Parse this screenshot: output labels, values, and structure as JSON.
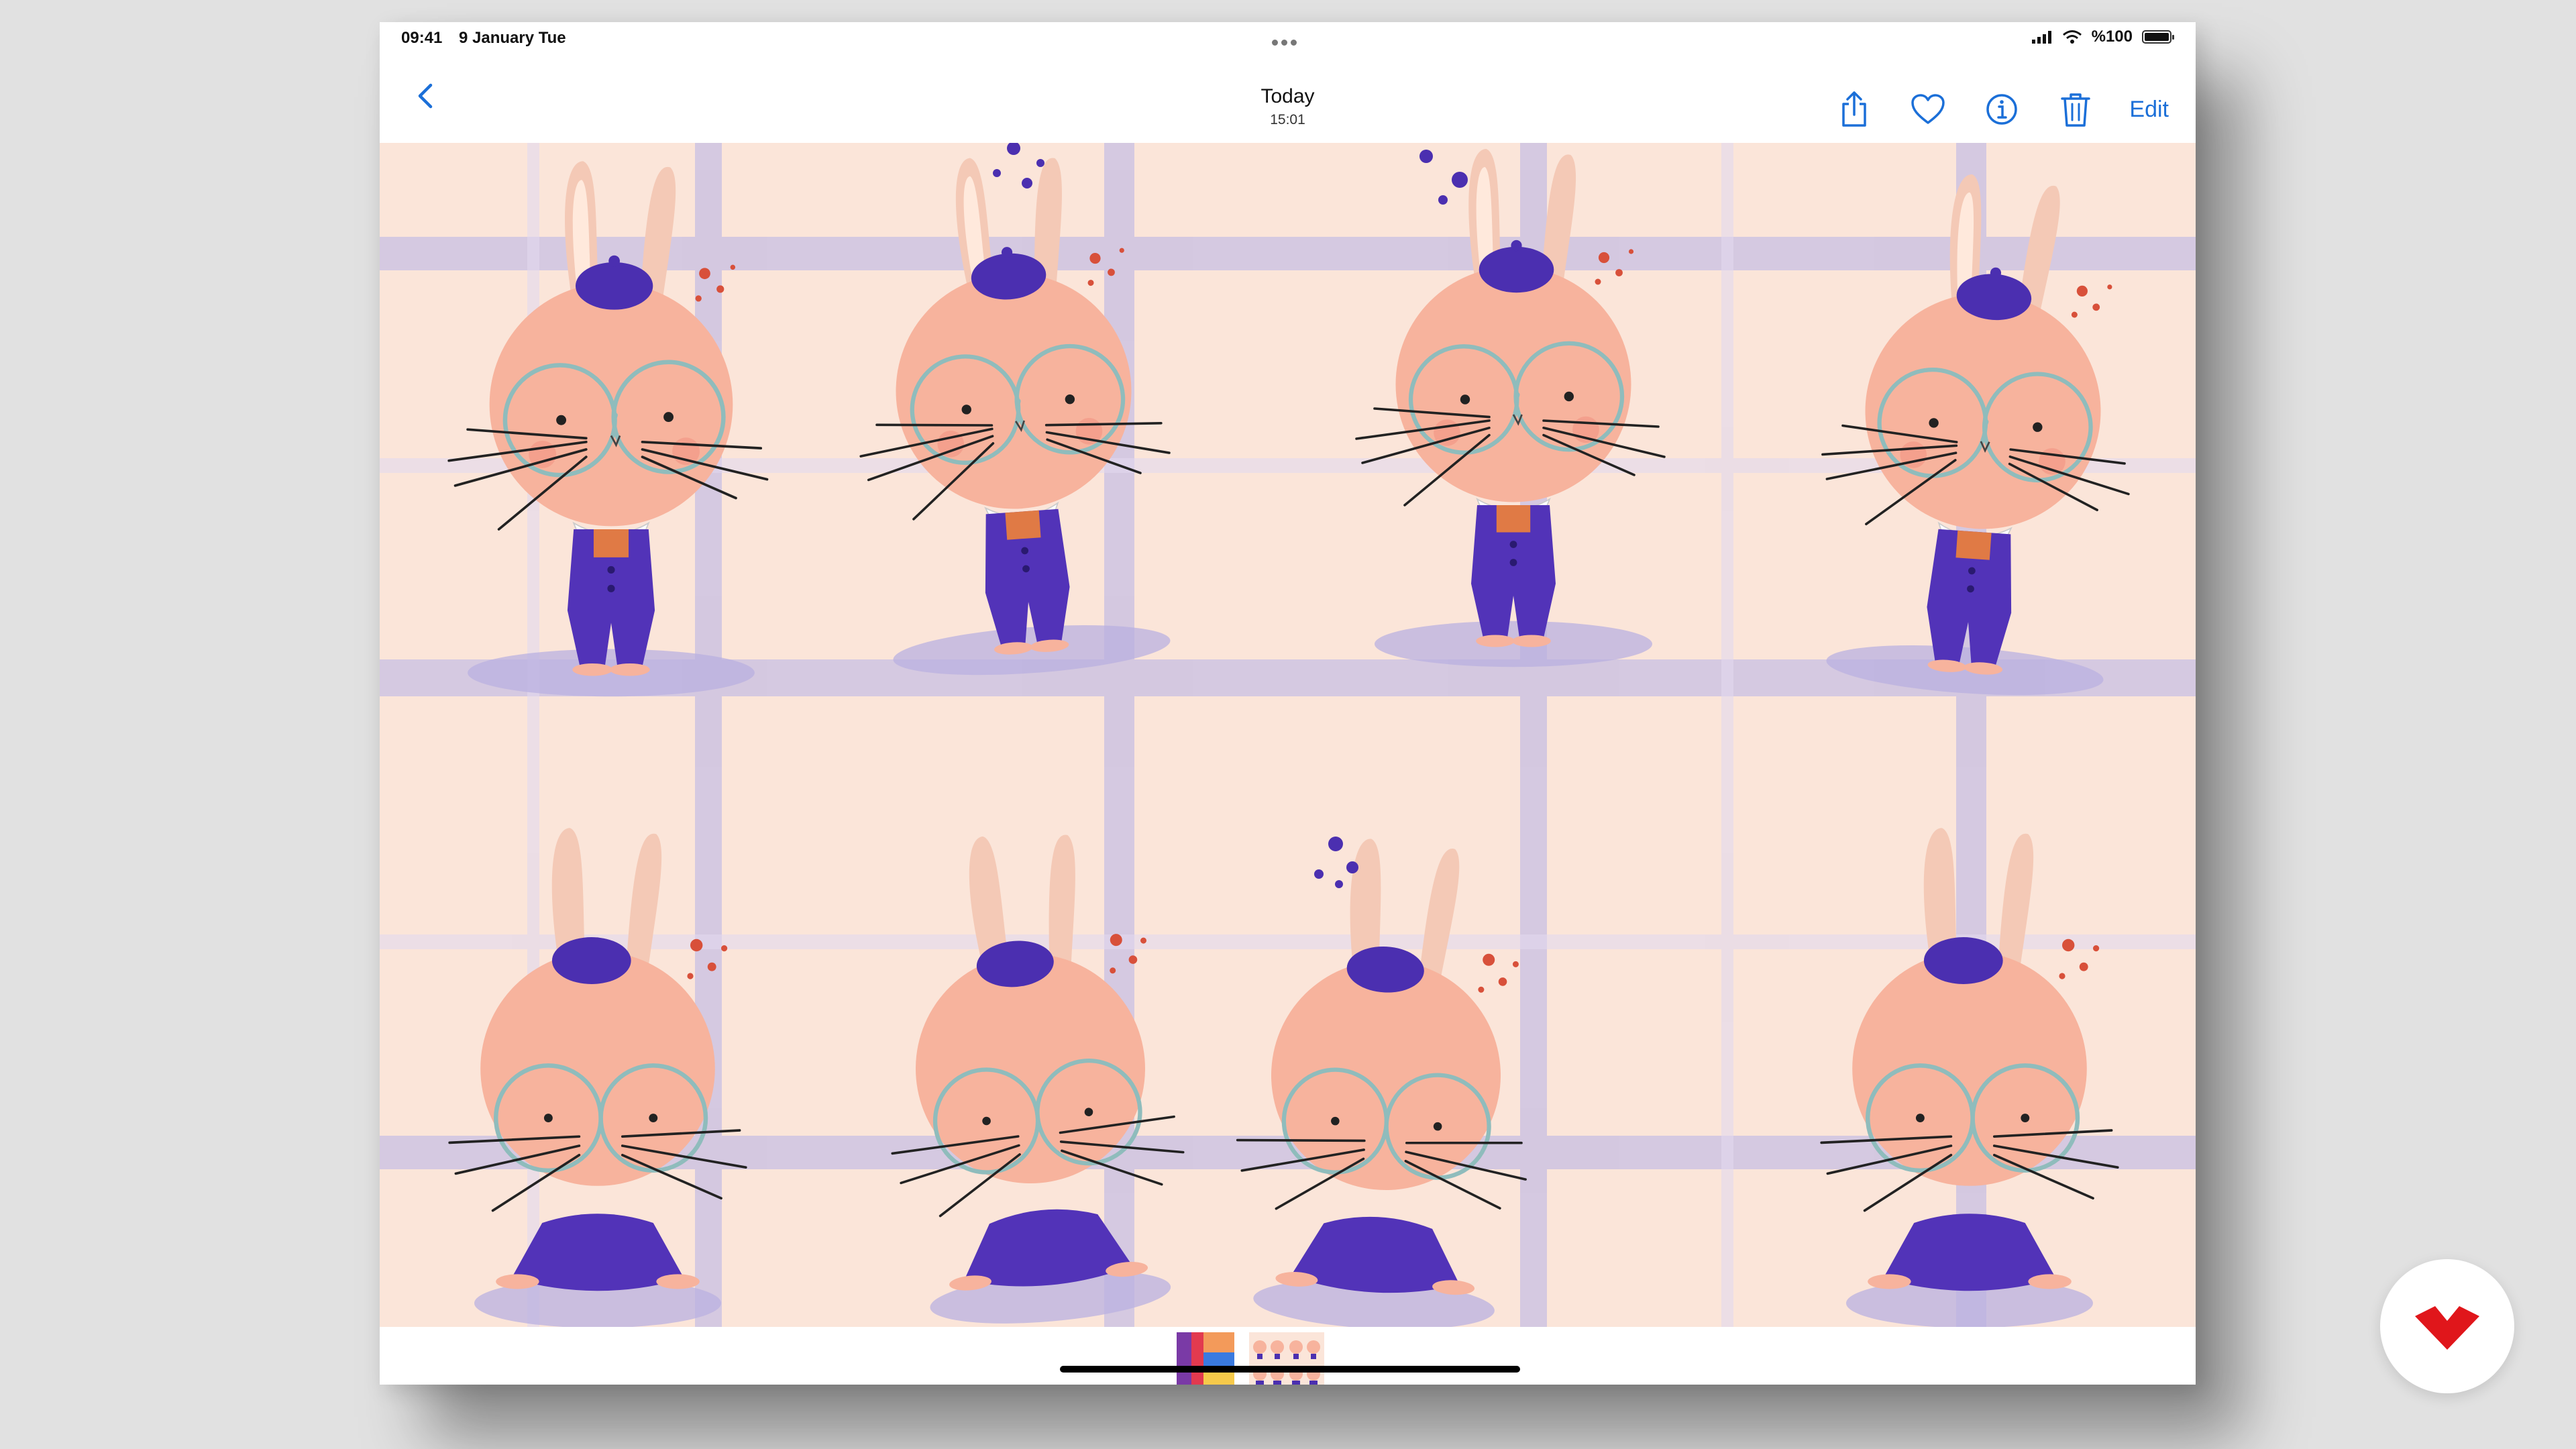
{
  "status_bar": {
    "time": "09:41",
    "date": "9 January Tue",
    "battery_label": "%100",
    "battery_percent": 100
  },
  "nav": {
    "title": "Today",
    "subtitle": "15:01",
    "edit_label": "Edit",
    "accent_color": "#1b6fd8"
  },
  "icons": [
    "chevron-left-icon",
    "share-icon",
    "heart-icon",
    "info-icon",
    "trash-icon",
    "signal-icon",
    "wifi-icon",
    "battery-icon",
    "multitasking-dots-icon"
  ],
  "photo": {
    "subject": "Eight pink bunny illustrations with round glasses, purple berets and purple overalls on a plaid background",
    "palette": {
      "background": "#fbe5d9",
      "plaid": "#c8bfe3",
      "bunny": "#f5b7a0",
      "beret": "#4b2fb0",
      "glasses": "#8fbcbc",
      "accent_dots": "#d8503a"
    }
  },
  "thumbnails": [
    "colorful-artwork",
    "bunny-sheet"
  ]
}
